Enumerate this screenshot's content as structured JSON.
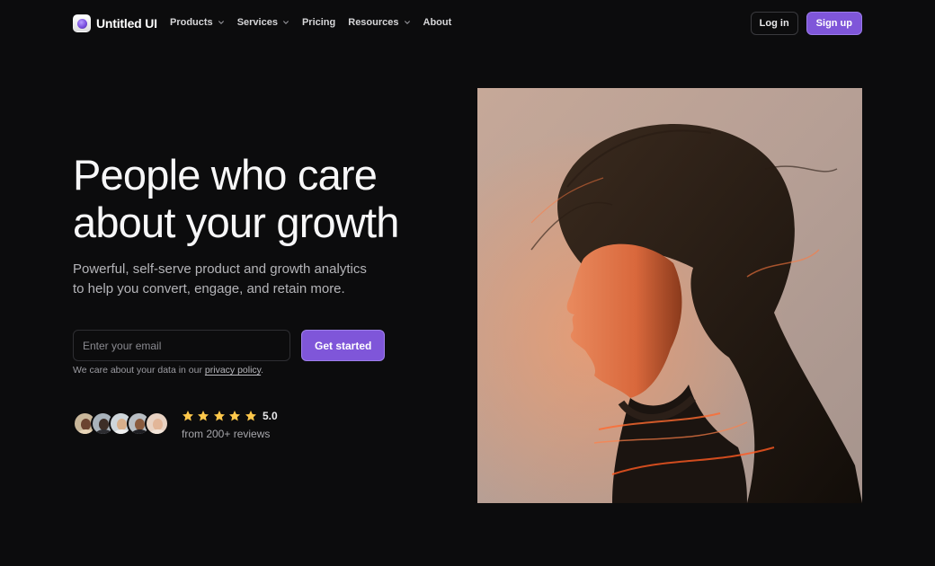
{
  "brand": {
    "name": "Untitled UI"
  },
  "nav": {
    "items": [
      {
        "label": "Products",
        "has_dropdown": true
      },
      {
        "label": "Services",
        "has_dropdown": true
      },
      {
        "label": "Pricing",
        "has_dropdown": false
      },
      {
        "label": "Resources",
        "has_dropdown": true
      },
      {
        "label": "About",
        "has_dropdown": false
      }
    ],
    "login_label": "Log in",
    "signup_label": "Sign up"
  },
  "hero": {
    "headline_line1": "People who care",
    "headline_line2": "about your growth",
    "subhead_line1": "Powerful, self-serve product and growth analytics",
    "subhead_line2": "to help you convert, engage, and retain more.",
    "email_placeholder": "Enter your email",
    "cta_label": "Get started",
    "privacy_prefix": "We care about your data in our ",
    "privacy_link": "privacy policy",
    "privacy_suffix": "."
  },
  "social_proof": {
    "avatar_count": 5,
    "stars": 5,
    "rating": "5.0",
    "reviews_text": "from 200+ reviews"
  },
  "colors": {
    "background": "#0c0c0d",
    "accent": "#7f56d9",
    "star": "#fec84b"
  },
  "icons": [
    "chevron-down-icon",
    "star-icon",
    "logo-icon"
  ]
}
